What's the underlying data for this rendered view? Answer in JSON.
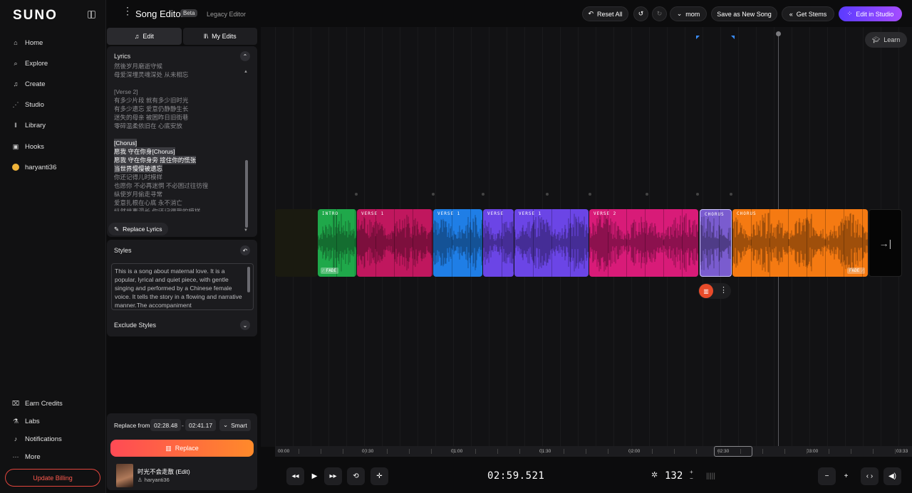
{
  "sidebar": {
    "logo": "SUNO",
    "items": [
      {
        "label": "Home",
        "icon": "home-icon",
        "glyph": "⌂"
      },
      {
        "label": "Explore",
        "icon": "search-icon",
        "glyph": "⌕"
      },
      {
        "label": "Create",
        "icon": "music-note-icon",
        "glyph": "♫"
      },
      {
        "label": "Studio",
        "icon": "studio-icon",
        "glyph": "⋰"
      },
      {
        "label": "Library",
        "icon": "library-icon",
        "glyph": "‖"
      },
      {
        "label": "Hooks",
        "icon": "hooks-icon",
        "glyph": "▣"
      },
      {
        "label": "haryanti36",
        "icon": "avatar",
        "glyph": ""
      }
    ],
    "bottom_items": [
      {
        "label": "Earn Credits",
        "icon": "gift-icon",
        "glyph": "⌧"
      },
      {
        "label": "Labs",
        "icon": "flask-icon",
        "glyph": "⚗"
      },
      {
        "label": "Notifications",
        "icon": "bell-icon",
        "glyph": "♪"
      },
      {
        "label": "More",
        "icon": "more-icon",
        "glyph": "···"
      }
    ],
    "update_billing": "Update Billing"
  },
  "header": {
    "title": "Song Editor",
    "beta": "Beta",
    "legacy": "Legacy Editor",
    "reset_all": "Reset All",
    "model": "mom",
    "save_as_new": "Save as New Song",
    "get_stems": "Get Stems",
    "edit_in_studio": "Edit in Studio"
  },
  "panel": {
    "tab_edit": "Edit",
    "tab_my_edits": "My Edits",
    "lyrics_title": "Lyrics",
    "lyrics_lines": [
      {
        "text": "然後岁月磨逝守候",
        "hl": false
      },
      {
        "text": "母爱深埋灵魂深处 从未相忘",
        "hl": false
      },
      {
        "text": "",
        "hl": false
      },
      {
        "text": "[Verse 2]",
        "hl": false
      },
      {
        "text": "有多少片段 就有多少旧时光",
        "hl": false
      },
      {
        "text": "有多少遗忘 爱意仍静静生长",
        "hl": false
      },
      {
        "text": "迷失的母亲 被困昨日旧街巷",
        "hl": false
      },
      {
        "text": "零碎温柔依旧在 心底安放",
        "hl": false
      },
      {
        "text": "",
        "hl": false
      },
      {
        "text": "[Chorus]",
        "hl": true
      },
      {
        "text": "愿我 守在你身[Chorus]",
        "hl": true
      },
      {
        "text": "愿我 守在你身旁 接住你的慌张",
        "hl": true
      },
      {
        "text": "当世界慢慢被遗忘",
        "hl": true
      },
      {
        "text": "你还记得儿时模样",
        "hl": false
      },
      {
        "text": "也愿你 不必再迷惘 不必困过往彷徨",
        "hl": false
      },
      {
        "text": "纵使岁月偷走寻常",
        "hl": false
      },
      {
        "text": "爱意扎根在心底 永不消亡",
        "hl": false
      },
      {
        "text": "纵然世事漫长 你还记得我的模样",
        "hl": false
      }
    ],
    "replace_lyrics": "Replace Lyrics",
    "styles_title": "Styles",
    "styles_text": "This is a song about maternal love. It is a popular, lyrical and quiet piece, with gentle singing and performed by a Chinese female voice. It tells the story in a flowing and narrative manner.The accompaniment",
    "exclude_styles": "Exclude Styles",
    "replace_from_label": "Replace from",
    "replace_from": "02:28.48",
    "replace_dash": "-",
    "replace_to": "02:41.17",
    "smart": "Smart",
    "replace_button": "Replace",
    "song_title": "时光不会走散 (Edit)",
    "song_user": "haryanti36"
  },
  "timeline": {
    "learn": "Learn",
    "sections": [
      {
        "label": "INTRO",
        "color": "#1fa84a",
        "fade": "FADE"
      },
      {
        "label": "VERSE 1",
        "color": "#c0175e",
        "fade": ""
      },
      {
        "label": "VERSE 1",
        "color": "#1f7ee6",
        "fade": ""
      },
      {
        "label": "VERSE",
        "color": "#6b45e6",
        "fade": ""
      },
      {
        "label": "VERSE 1",
        "color": "#6b45e6",
        "fade": ""
      },
      {
        "label": "VERSE 2",
        "color": "#d81b78",
        "fade": ""
      },
      {
        "label": "CHORUS",
        "color": "#7a5ccf",
        "fade": ""
      },
      {
        "label": "CHORUS",
        "color": "#f57a12",
        "fade": "FADE"
      }
    ],
    "ruler": [
      "00:00",
      "00:30",
      "01:00",
      "01:30",
      "02:00",
      "02:30",
      "03:00",
      "03:33"
    ]
  },
  "transport": {
    "clock": "02:59.521",
    "bpm": "132"
  }
}
